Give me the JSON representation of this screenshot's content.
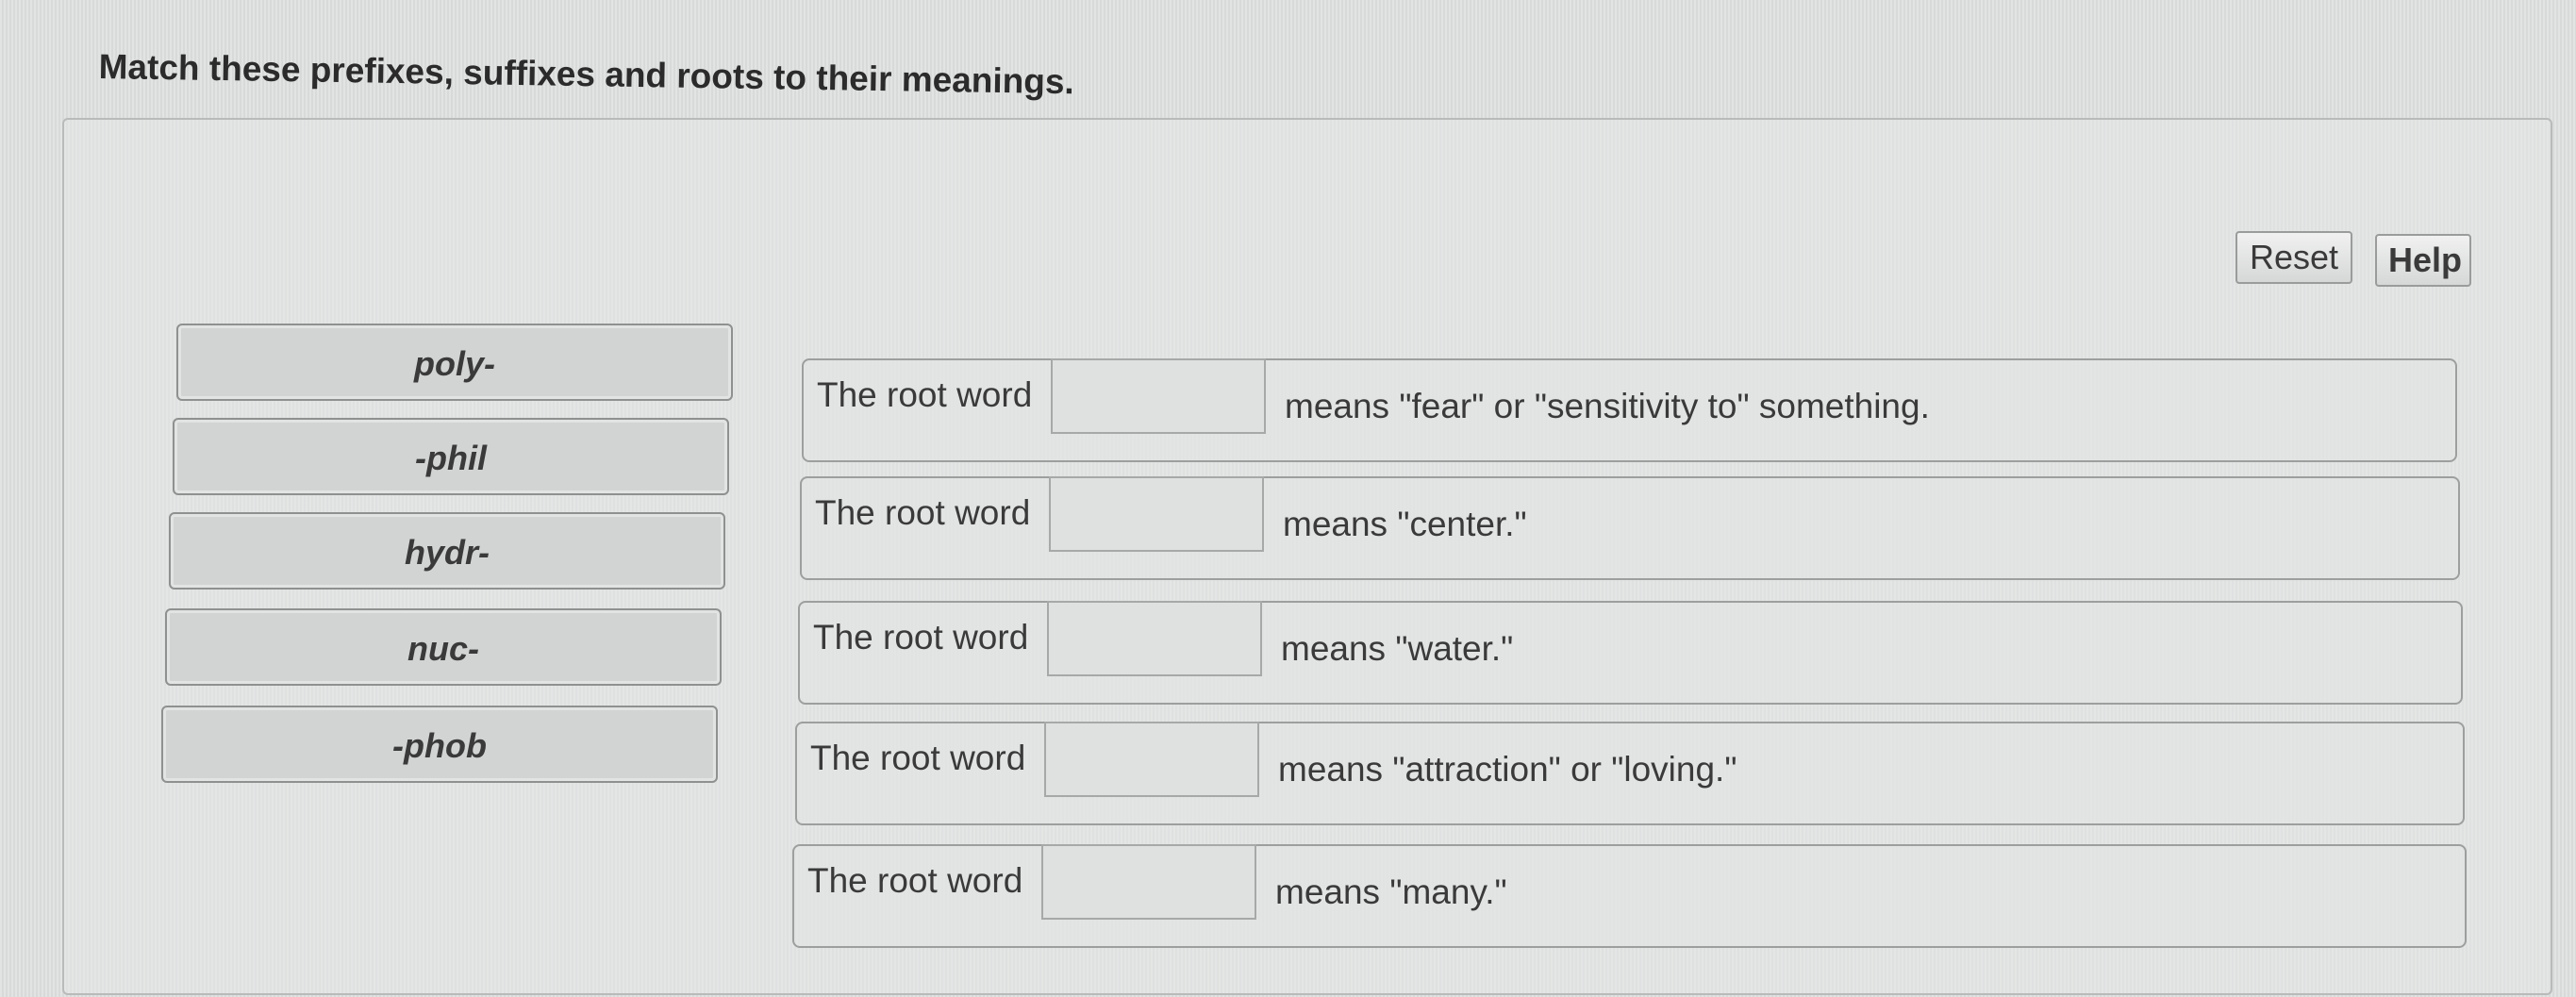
{
  "instructions": "Match these prefixes, suffixes and roots to their meanings.",
  "buttons": {
    "reset": "Reset",
    "help": "Help"
  },
  "tiles": [
    "poly-",
    "-phil",
    "hydr-",
    "nuc-",
    "-phob"
  ],
  "rows": [
    {
      "lead": "The root word",
      "trail": "means \"fear\" or \"sensitivity to\" something."
    },
    {
      "lead": "The root word",
      "trail": "means \"center.\""
    },
    {
      "lead": "The root word",
      "trail": "means \"water.\""
    },
    {
      "lead": "The root word",
      "trail": "means \"attraction\" or \"loving.\""
    },
    {
      "lead": "The root word",
      "trail": "means \"many.\""
    }
  ]
}
